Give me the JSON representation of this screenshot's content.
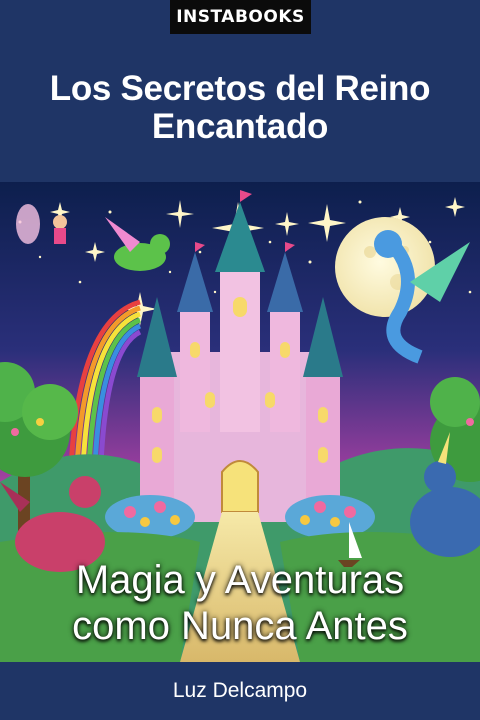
{
  "cover": {
    "brand": "INSTABOOKS",
    "title_line1": "Los Secretos del Reino",
    "title_line2": "Encantado",
    "subtitle_line1": "Magia y Aventuras",
    "subtitle_line2": "como Nunca Antes",
    "author": "Luz Delcampo"
  },
  "colors": {
    "background": "#1f3566",
    "brand_bg": "#0b0b0b",
    "text": "#ffffff"
  },
  "illustration": {
    "elements": [
      "castle",
      "full-moon",
      "rainbow",
      "fairy",
      "green-dragon",
      "blue-dragon",
      "pink-dragon",
      "unicorn",
      "stars",
      "trees",
      "flowers",
      "sailboat"
    ]
  }
}
